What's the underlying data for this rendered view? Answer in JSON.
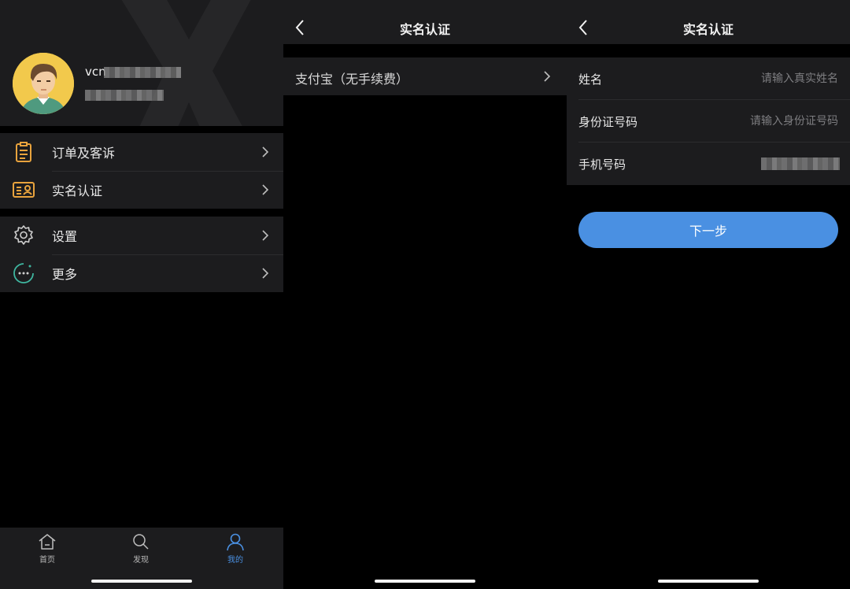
{
  "colors": {
    "panel_bg": "#1c1c1e",
    "screen_bg": "#000000",
    "accent_blue": "#4a90e2",
    "menu_orange": "#e8a33d",
    "menu_green": "#3fb6a0"
  },
  "profile": {
    "username_visible": "vcn",
    "avatar": "avatar-illustration"
  },
  "menu": {
    "group1": [
      {
        "label": "订单及客诉",
        "icon": "clipboard-icon"
      },
      {
        "label": "实名认证",
        "icon": "id-card-icon"
      }
    ],
    "group2": [
      {
        "label": "设置",
        "icon": "gear-icon"
      },
      {
        "label": "更多",
        "icon": "more-dots-icon"
      }
    ]
  },
  "tabbar": {
    "tabs": [
      {
        "label": "首页",
        "icon": "home-icon",
        "active": false
      },
      {
        "label": "发现",
        "icon": "search-icon",
        "active": false
      },
      {
        "label": "我的",
        "icon": "user-icon",
        "active": true
      }
    ]
  },
  "verify_method": {
    "title": "实名认证",
    "option": "支付宝（无手续费）"
  },
  "verify_form": {
    "title": "实名认证",
    "fields": [
      {
        "label": "姓名",
        "placeholder": "请输入真实姓名"
      },
      {
        "label": "身份证号码",
        "placeholder": "请输入身份证号码"
      },
      {
        "label": "手机号码",
        "placeholder": ""
      }
    ],
    "next_label": "下一步"
  }
}
